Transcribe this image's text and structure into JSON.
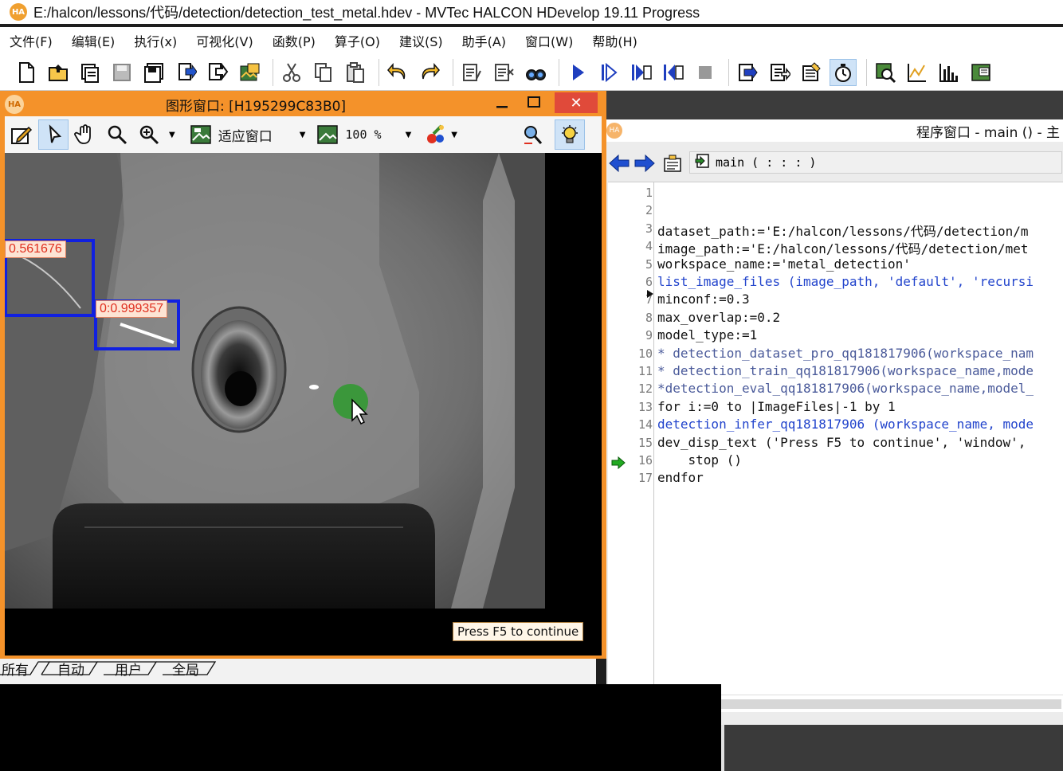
{
  "window": {
    "logo_text": "HA",
    "title": "E:/halcon/lessons/代码/detection/detection_test_metal.hdev - MVTec HALCON HDevelop 19.11 Progress"
  },
  "menu": [
    "文件(F)",
    "编辑(E)",
    "执行(x)",
    "可视化(V)",
    "函数(P)",
    "算子(O)",
    "建议(S)",
    "助手(A)",
    "窗口(W)",
    "帮助(H)"
  ],
  "graphics_window": {
    "logo_text": "HA",
    "caption": "图形窗口: [H195299C83B0]",
    "minimize": "‒",
    "close": "✕",
    "fit_label": "适应窗口",
    "zoom_label": "100 %",
    "detections": [
      {
        "label": "0.561676"
      },
      {
        "label": "0:0.999357"
      }
    ],
    "status_text": "Press F5 to continue"
  },
  "program_window": {
    "logo_text": "HA",
    "caption": "程序窗口 - main () - 主",
    "procedure": "main ( : : : )",
    "lines": [
      {
        "n": "1",
        "text": "",
        "style": "c-black"
      },
      {
        "n": "2",
        "text": "",
        "style": "c-black"
      },
      {
        "n": "3",
        "text": "dataset_path:='E:/halcon/lessons/代码/detection/m",
        "style": "c-black"
      },
      {
        "n": "4",
        "text": "image_path:='E:/halcon/lessons/代码/detection/met",
        "style": "c-black"
      },
      {
        "n": "5",
        "text": "workspace_name:='metal_detection'",
        "style": "c-black"
      },
      {
        "n": "6",
        "text": "list_image_files (image_path, 'default', 'recursi",
        "style": "c-blue"
      },
      {
        "n": "7",
        "text": "minconf:=0.3",
        "style": "c-black"
      },
      {
        "n": "8",
        "text": "max_overlap:=0.2",
        "style": "c-black"
      },
      {
        "n": "9",
        "text": "model_type:=1",
        "style": "c-black"
      },
      {
        "n": "10",
        "text": "* detection_dataset_pro_qq181817906(workspace_nam",
        "style": "c-com"
      },
      {
        "n": "11",
        "text": "* detection_train_qq181817906(workspace_name,mode",
        "style": "c-com"
      },
      {
        "n": "12",
        "text": "*detection_eval_qq181817906(workspace_name,model_",
        "style": "c-com"
      },
      {
        "n": "13",
        "text": "for i:=0 to |ImageFiles|-1 by 1",
        "style": "c-black"
      },
      {
        "n": "14",
        "text": "detection_infer_qq181817906 (workspace_name, mode",
        "style": "c-blue"
      },
      {
        "n": "15",
        "text": "dev_disp_text ('Press F5 to continue', 'window',",
        "style": "c-black"
      },
      {
        "n": "16",
        "text": "    stop ()",
        "style": "c-black"
      },
      {
        "n": "17",
        "text": "endfor",
        "style": "c-black"
      }
    ],
    "scroll_left": "<"
  },
  "variable_tabs": [
    "所有",
    "自动",
    "用户",
    "全局"
  ],
  "colors": {
    "graphics_frame": "#f4922a",
    "detection_box": "#1020e0",
    "label_bg": "#fde4d4",
    "label_text": "#e03020",
    "pc_arrow": "#22aa22"
  }
}
